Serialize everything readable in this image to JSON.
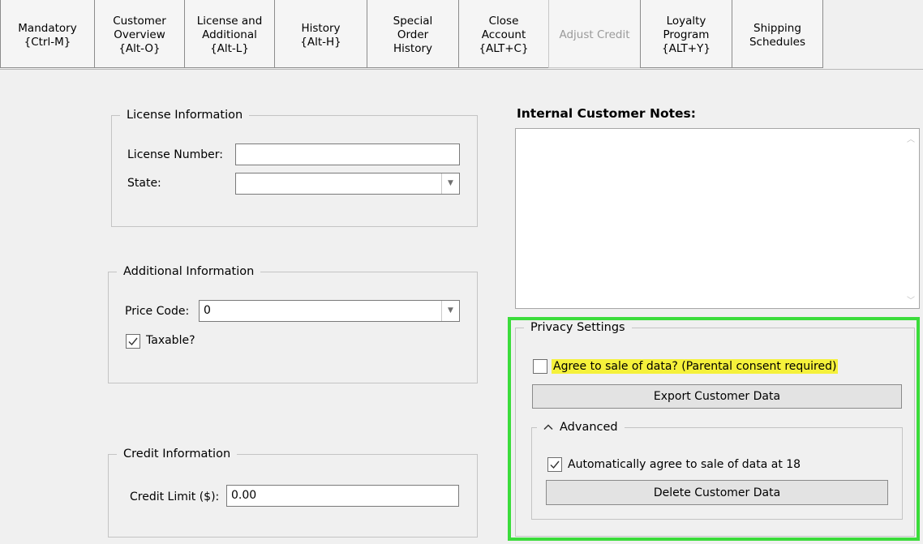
{
  "tabs": [
    {
      "label": "Mandatory\n{Ctrl-M}",
      "disabled": false
    },
    {
      "label": "Customer\nOverview\n{Alt-O}",
      "disabled": false
    },
    {
      "label": "License and\nAdditional\n{Alt-L}",
      "disabled": false
    },
    {
      "label": "History\n{Alt-H}",
      "disabled": false
    },
    {
      "label": "Special\nOrder\nHistory",
      "disabled": false
    },
    {
      "label": "Close\nAccount\n{ALT+C}",
      "disabled": false
    },
    {
      "label": "Adjust Credit",
      "disabled": true
    },
    {
      "label": "Loyalty\nProgram\n{ALT+Y}",
      "disabled": false
    },
    {
      "label": "Shipping\nSchedules",
      "disabled": false
    }
  ],
  "license": {
    "legend": "License Information",
    "number_label": "License Number:",
    "number_value": "",
    "state_label": "State:",
    "state_value": ""
  },
  "additional": {
    "legend": "Additional Information",
    "price_code_label": "Price Code:",
    "price_code_value": "0",
    "taxable_label": "Taxable?",
    "taxable_checked": true
  },
  "credit": {
    "legend": "Credit Information",
    "limit_label": "Credit Limit ($):",
    "limit_value": "0.00"
  },
  "notes": {
    "title": "Internal Customer Notes:",
    "value": ""
  },
  "privacy": {
    "legend": "Privacy Settings",
    "agree_label": "Agree to sale of data? (Parental consent required)",
    "agree_checked": false,
    "export_button": "Export Customer Data",
    "advanced_legend": "Advanced",
    "auto_agree_label": "Automatically agree to sale of data at 18",
    "auto_agree_checked": true,
    "delete_button": "Delete Customer Data"
  },
  "icons": {
    "dropdown": "chevron-down-icon",
    "collapse": "chevron-up-icon",
    "check": "checkmark-icon"
  },
  "colors": {
    "highlight_border": "#3bdc3b",
    "highlight_text_bg": "#f5f13b"
  }
}
